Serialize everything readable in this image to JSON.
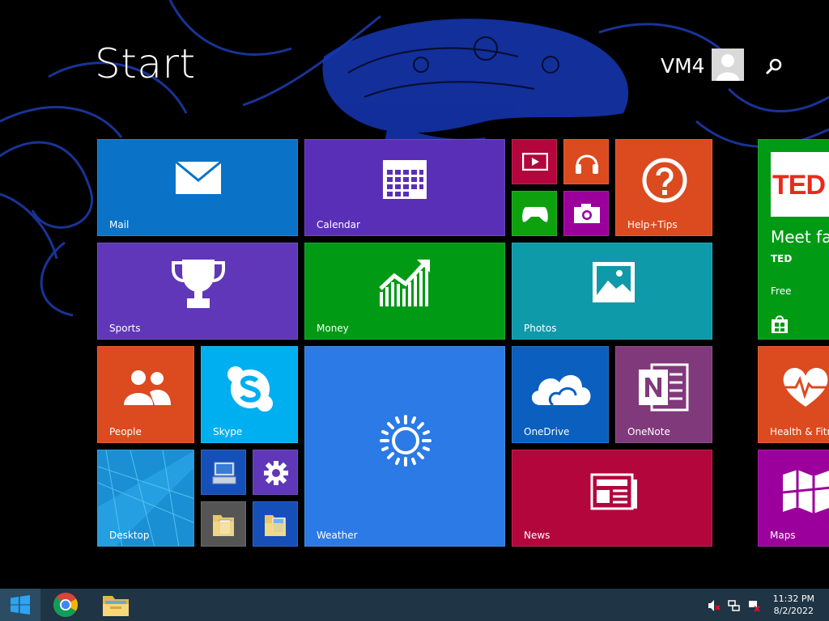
{
  "screen": {
    "title": "Start",
    "user_name": "VM4"
  },
  "tiles": {
    "mail": "Mail",
    "calendar": "Calendar",
    "help_tips": "Help+Tips",
    "sports": "Sports",
    "money": "Money",
    "photos": "Photos",
    "people": "People",
    "skype": "Skype",
    "weather": "Weather",
    "onedrive": "OneDrive",
    "onenote": "OneNote",
    "desktop": "Desktop",
    "news": "News",
    "health": "Health & Fitne",
    "maps": "Maps",
    "ted": {
      "logo_text": "TED",
      "headline": "Meet fas",
      "publisher": "TED",
      "price": "Free"
    }
  },
  "taskbar": {
    "time": "11:32 PM",
    "date": "8/2/2022"
  },
  "colors": {
    "mail": "#0a73c8",
    "calendar": "#5a2fb8",
    "video": "#b3063d",
    "music": "#dc4a1f",
    "help": "#dc4a1f",
    "games": "#0ea10e",
    "camera": "#9c009c",
    "sports": "#5f37b8",
    "money": "#009a15",
    "photos": "#0f9aaa",
    "people": "#dc4a1f",
    "skype": "#00aff0",
    "weather": "#2b7ae6",
    "onedrive": "#0a5fbf",
    "onenote": "#80397b",
    "news": "#b3063d",
    "ted": "#009a15",
    "health": "#dc4a1f",
    "maps": "#9c009c",
    "taskbar": "#1f3444"
  }
}
